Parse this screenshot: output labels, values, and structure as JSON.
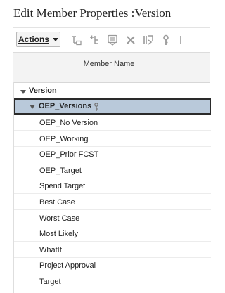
{
  "dialog": {
    "title": "Edit Member Properties :Version"
  },
  "toolbar": {
    "actions_label": "Actions",
    "icons": [
      "add-child-icon",
      "add-sibling-icon",
      "edit-properties-icon",
      "delete-icon",
      "move-icon",
      "key-icon"
    ]
  },
  "grid": {
    "column_header": "Member Name",
    "root": {
      "label": "Version",
      "expanded": true
    },
    "selected": {
      "label": "OEP_Versions",
      "expanded": true,
      "icon": "key-icon"
    },
    "members": [
      "OEP_No Version",
      "OEP_Working",
      "OEP_Prior FCST",
      "OEP_Target",
      "Spend Target",
      "Best Case",
      "Worst Case",
      "Most Likely",
      "WhatIf",
      "Project Approval",
      "Target"
    ]
  },
  "colors": {
    "selected_row": "#b9c9da",
    "header_bg": "#f3f3f3"
  }
}
